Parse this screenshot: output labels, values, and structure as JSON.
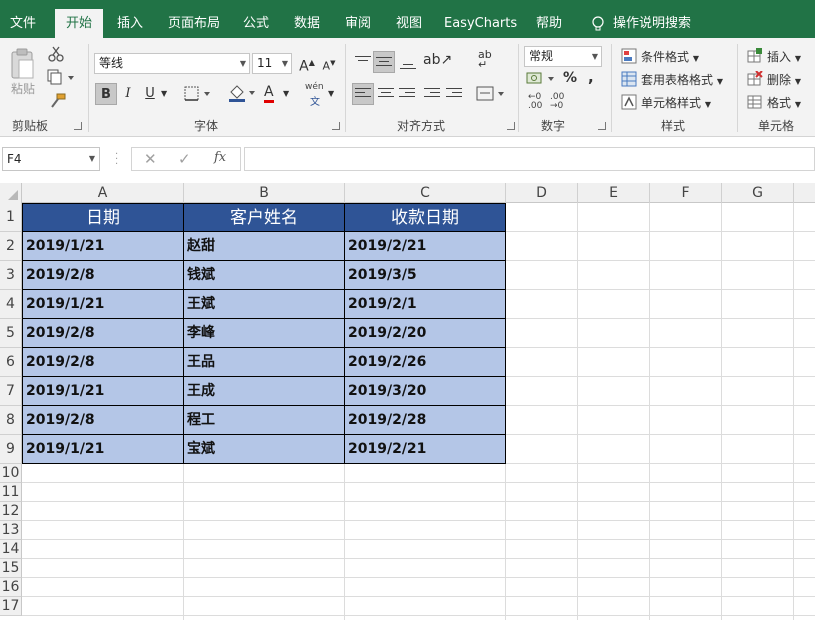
{
  "ribbon_tabs": [
    "文件",
    "开始",
    "插入",
    "页面布局",
    "公式",
    "数据",
    "审阅",
    "视图",
    "EasyCharts",
    "帮助",
    "操作说明搜索"
  ],
  "clipboard": {
    "paste_label": "粘贴",
    "group": "剪贴板"
  },
  "font": {
    "name": "等线",
    "size": "11",
    "group": "字体",
    "bold": "B",
    "italic": "I",
    "underline": "U",
    "grow": "A",
    "shrink": "A",
    "font_color": "A",
    "phonetic": "wén"
  },
  "alignment": {
    "group": "对齐方式"
  },
  "number": {
    "format": "常规",
    "percent": "%",
    "comma": ",",
    "group": "数字"
  },
  "styles": {
    "conditional": "条件格式",
    "table": "套用表格格式",
    "cell_styles": "单元格样式",
    "group": "样式"
  },
  "cells": {
    "insert": "插入",
    "delete": "删除",
    "format": "格式",
    "group": "单元格"
  },
  "name_box": "F4",
  "fx_label": "fx",
  "columns": [
    "A",
    "B",
    "C",
    "D",
    "E",
    "F",
    "G"
  ],
  "rows": [
    "1",
    "2",
    "3",
    "4",
    "5",
    "6",
    "7",
    "8",
    "9",
    "10",
    "11",
    "12",
    "13",
    "14",
    "15",
    "16",
    "17"
  ],
  "table": {
    "headers": [
      "日期",
      "客户姓名",
      "收款日期"
    ],
    "rows": [
      [
        "2019/1/21",
        "赵甜",
        "2019/2/21"
      ],
      [
        "2019/2/8",
        "钱斌",
        "2019/3/5"
      ],
      [
        "2019/1/21",
        "王斌",
        "2019/2/1"
      ],
      [
        "2019/2/8",
        "李峰",
        "2019/2/20"
      ],
      [
        "2019/2/8",
        "王品",
        "2019/2/26"
      ],
      [
        "2019/1/21",
        "王成",
        "2019/3/20"
      ],
      [
        "2019/2/8",
        "程工",
        "2019/2/28"
      ],
      [
        "2019/1/21",
        "宝斌",
        "2019/2/21"
      ]
    ]
  },
  "colors": {
    "brand": "#217346",
    "header_fill": "#2f5496",
    "data_fill": "#b4c6e7"
  }
}
